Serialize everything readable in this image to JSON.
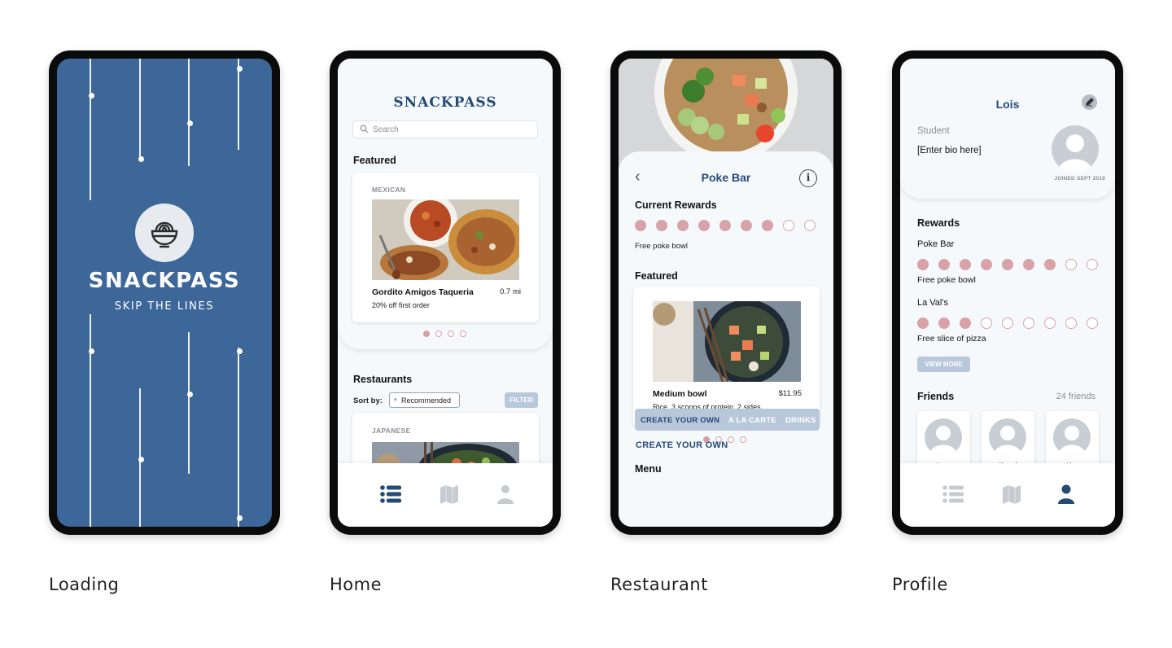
{
  "captions": {
    "loading": "Loading",
    "home": "Home",
    "restaurant": "Restaurant",
    "profile": "Profile"
  },
  "colors": {
    "brand_blue": "#244a77",
    "loading_bg": "#3d6799",
    "reward_pink": "#d7a3a9",
    "soft_blue": "#b8c8da"
  },
  "loading": {
    "brand": "SNACKPASS",
    "tagline": "SKIP THE LINES",
    "logo_icon": "bowl-icon"
  },
  "home": {
    "brand": "SNACKPASS",
    "search_placeholder": "Search",
    "featured_title": "Featured",
    "featured_card": {
      "tag": "MEXICAN",
      "name": "Gordito Amigos Taqueria",
      "distance": "0.7 mi",
      "deal": "20% off first order"
    },
    "restaurants_title": "Restaurants",
    "sort_label": "Sort by:",
    "sort_value": "Recommended",
    "filter_label": "FILTER",
    "restaurant_card": {
      "tag": "JAPANESE"
    },
    "tabs": [
      "list-icon",
      "map-icon",
      "profile-icon"
    ]
  },
  "restaurant": {
    "name": "Poke Bar",
    "rewards_title": "Current Rewards",
    "rewards_filled": 7,
    "rewards_total": 9,
    "reward_text": "Free poke bowl",
    "featured_title": "Featured",
    "item": {
      "name": "Medium bowl",
      "price": "$11.95",
      "desc": "Rice, 3 scoops of protein, 2 sides"
    },
    "menu_title": "Menu",
    "menu_tabs": [
      "CREATE YOUR OWN",
      "A LA CARTE",
      "DRINKS"
    ],
    "menu_section": "CREATE YOUR OWN"
  },
  "profile": {
    "name": "Lois",
    "role": "Student",
    "bio": "[Enter bio here]",
    "joined": "JOINED SEPT 2018",
    "rewards_title": "Rewards",
    "rewards": [
      {
        "name": "Poke Bar",
        "filled": 7,
        "total": 9,
        "reward": "Free poke bowl"
      },
      {
        "name": "La Val's",
        "filled": 3,
        "total": 9,
        "reward": "Free slice of pizza"
      }
    ],
    "view_more": "VIEW MORE",
    "friends_title": "Friends",
    "friends_count": "24 friends",
    "friends": [
      "Leon",
      "Komal",
      "Van"
    ]
  }
}
